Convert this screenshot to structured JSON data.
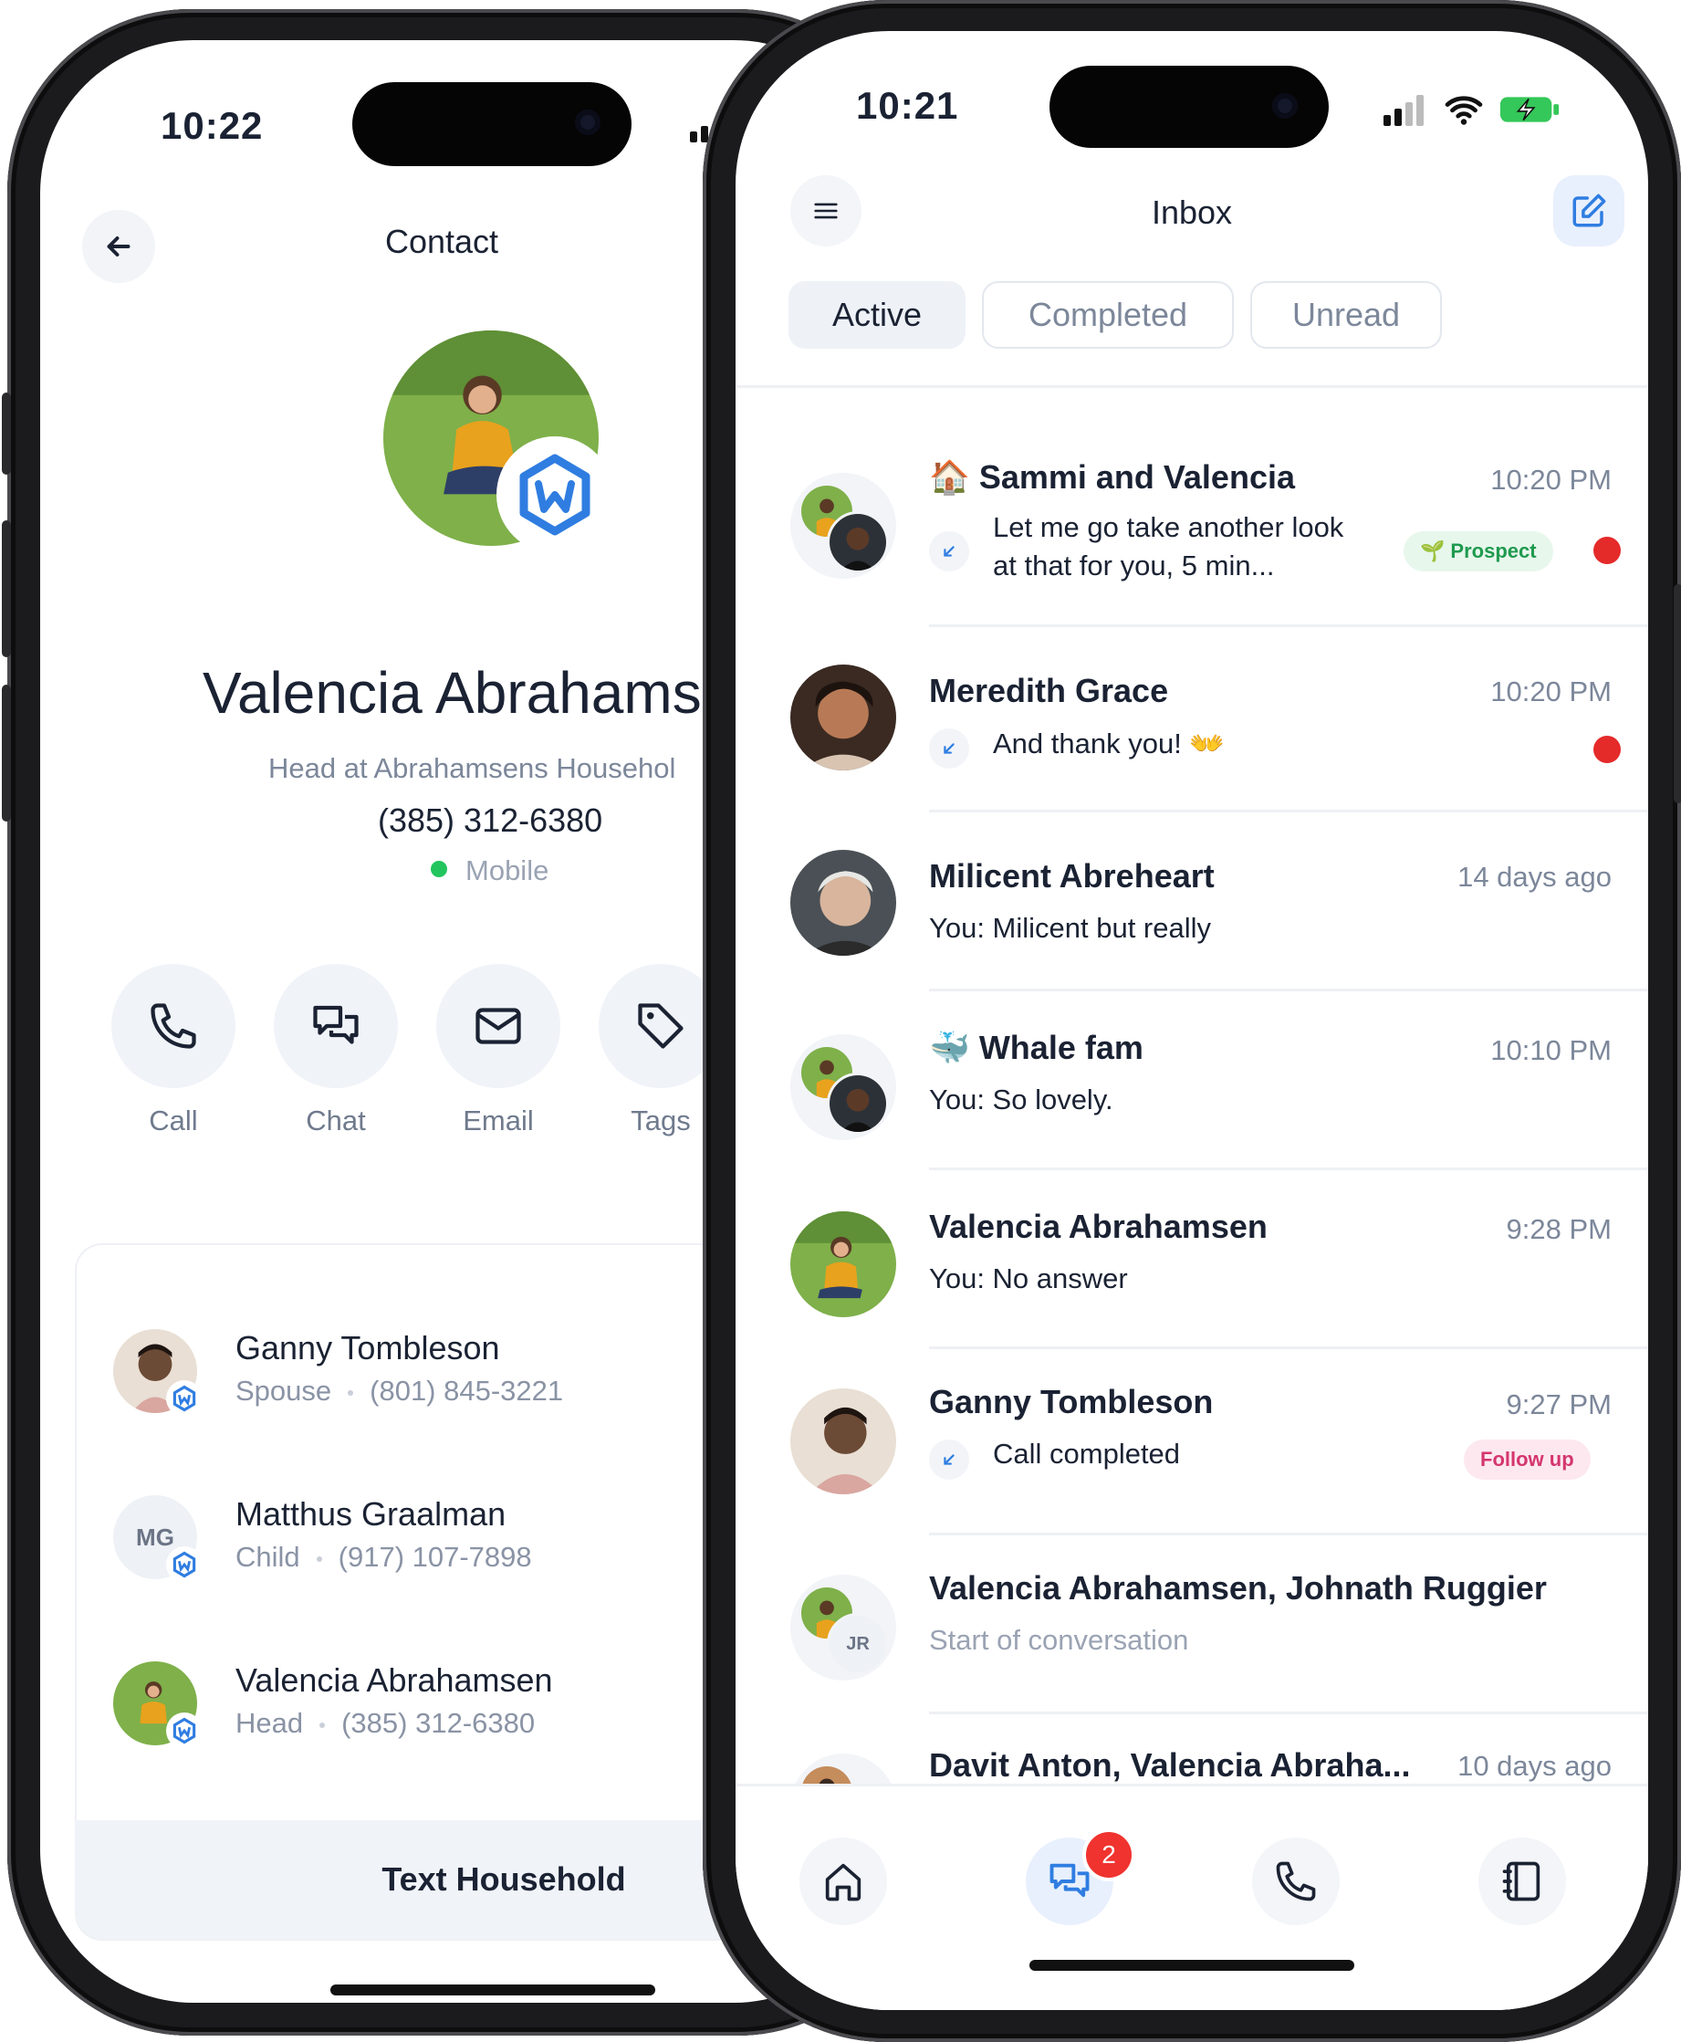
{
  "left": {
    "status_time": "10:22",
    "header_title": "Contact",
    "contact": {
      "name": "Valencia Abrahams",
      "subtitle": "Head at Abrahamsens Househol",
      "phone": "(385) 312-6380",
      "phone_type": "Mobile"
    },
    "actions": [
      {
        "label": "Call",
        "icon": "phone-icon"
      },
      {
        "label": "Chat",
        "icon": "chat-icon"
      },
      {
        "label": "Email",
        "icon": "mail-icon"
      },
      {
        "label": "Tags",
        "icon": "tag-icon"
      }
    ],
    "household": [
      {
        "name": "Ganny Tombleson",
        "role": "Spouse",
        "phone": "(801) 845-3221"
      },
      {
        "name": "Matthus Graalman",
        "role": "Child",
        "phone": "(917) 107-7898",
        "initials": "MG"
      },
      {
        "name": "Valencia Abrahamsen",
        "role": "Head",
        "phone": "(385) 312-6380"
      }
    ],
    "text_household_label": "Text Household"
  },
  "right": {
    "status_time": "10:21",
    "header_title": "Inbox",
    "tabs": [
      "Active",
      "Completed",
      "Unread"
    ],
    "conversations": [
      {
        "name": "🏠 Sammi and Valencia",
        "time": "10:20 PM",
        "preview_line1": "Let me go take another look",
        "preview_line2": "at that for you, 5 min...",
        "tag": "Prospect",
        "unread": true
      },
      {
        "name": "Meredith Grace",
        "time": "10:20 PM",
        "preview": "And thank you! 👐",
        "unread": true
      },
      {
        "name": "Milicent Abreheart",
        "time": "14 days ago",
        "preview": "You: Milicent but really"
      },
      {
        "name": "🐳 Whale fam",
        "time": "10:10 PM",
        "preview": "You: So lovely."
      },
      {
        "name": "Valencia Abrahamsen",
        "time": "9:28 PM",
        "preview": "You: No answer"
      },
      {
        "name": "Ganny Tombleson",
        "time": "9:27 PM",
        "preview": "Call completed",
        "tag": "Follow up"
      },
      {
        "name": "Valencia Abrahamsen, Johnath Ruggier",
        "preview": "Start of conversation",
        "initials": "JR"
      },
      {
        "name": "Davit Anton, Valencia Abraha...",
        "time": "10 days ago"
      }
    ],
    "nav_badge": "2",
    "nav": [
      "home-icon",
      "chat-icon",
      "phone-icon",
      "contacts-book-icon"
    ]
  },
  "colors": {
    "accent_blue": "#2f7de1",
    "unread_red": "#e52a2a",
    "prospect_green": "#1f9a4e",
    "follow_pink": "#d4366e",
    "mobile_green": "#22c55e"
  }
}
